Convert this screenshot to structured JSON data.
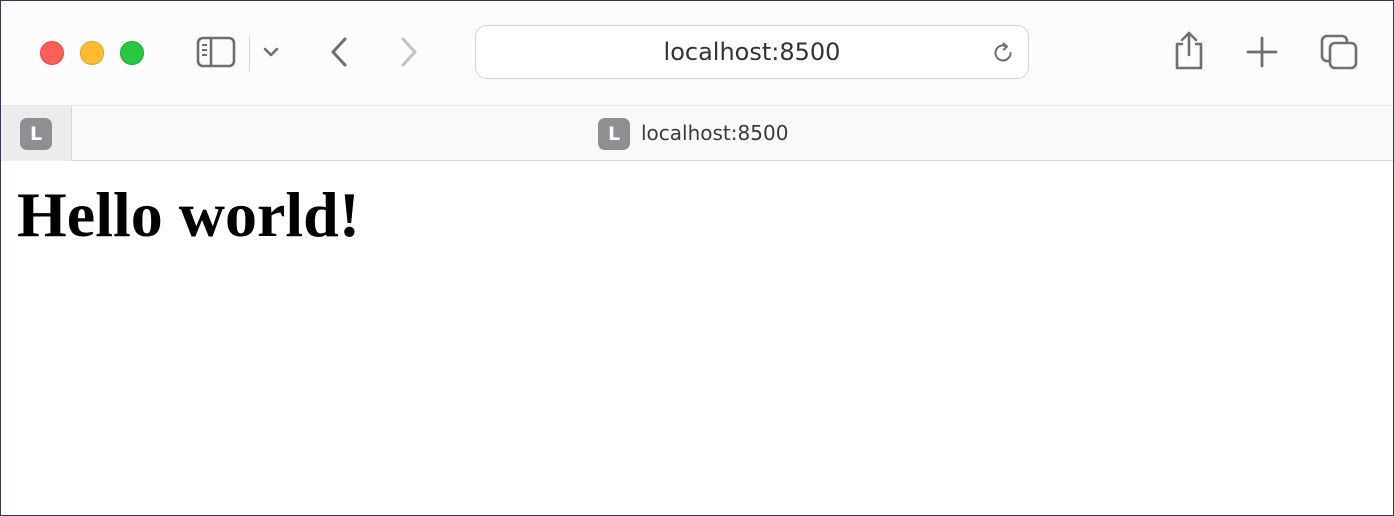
{
  "browser": {
    "address_bar": {
      "url": "localhost:8500"
    },
    "tabs": [
      {
        "favicon_letter": "L",
        "title": ""
      },
      {
        "favicon_letter": "L",
        "title": "localhost:8500"
      }
    ],
    "icons": {
      "sidebar": "sidebar-icon",
      "sidebar_menu": "chevron-down-icon",
      "back": "chevron-left-icon",
      "forward": "chevron-right-icon",
      "reload": "reload-icon",
      "share": "share-icon",
      "new_tab": "plus-icon",
      "tab_overview": "tabs-overview-icon"
    },
    "colors": {
      "close": "#ff5f57",
      "minimize": "#febc2e",
      "zoom": "#28c840"
    }
  },
  "page": {
    "heading": "Hello world!"
  }
}
